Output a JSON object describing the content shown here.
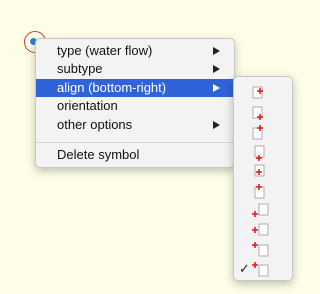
{
  "menu": {
    "items": [
      {
        "label": "type (water flow)",
        "has_submenu": true
      },
      {
        "label": "subtype",
        "has_submenu": true
      },
      {
        "label": "align (bottom-right)",
        "has_submenu": true,
        "highlighted": true
      },
      {
        "label": "orientation",
        "has_submenu": false
      },
      {
        "label": "other options",
        "has_submenu": true
      }
    ],
    "delete_label": "Delete symbol"
  },
  "align_submenu": {
    "selected_mark": "✓",
    "selected_index": 9,
    "options": [
      "align-top-left-icon",
      "align-top-center-icon",
      "align-top-right-icon",
      "align-center-left-icon",
      "align-center-icon",
      "align-center-right-icon",
      "align-bottom-left-icon",
      "align-bottom-center-icon",
      "align-bottom-right-icon",
      "align-bottom-right-icon"
    ]
  },
  "colors": {
    "highlight": "#2f63d8",
    "marker_ring": "#d23a3a",
    "marker_dot": "#2f7fd6",
    "anchor": "#e02020"
  }
}
